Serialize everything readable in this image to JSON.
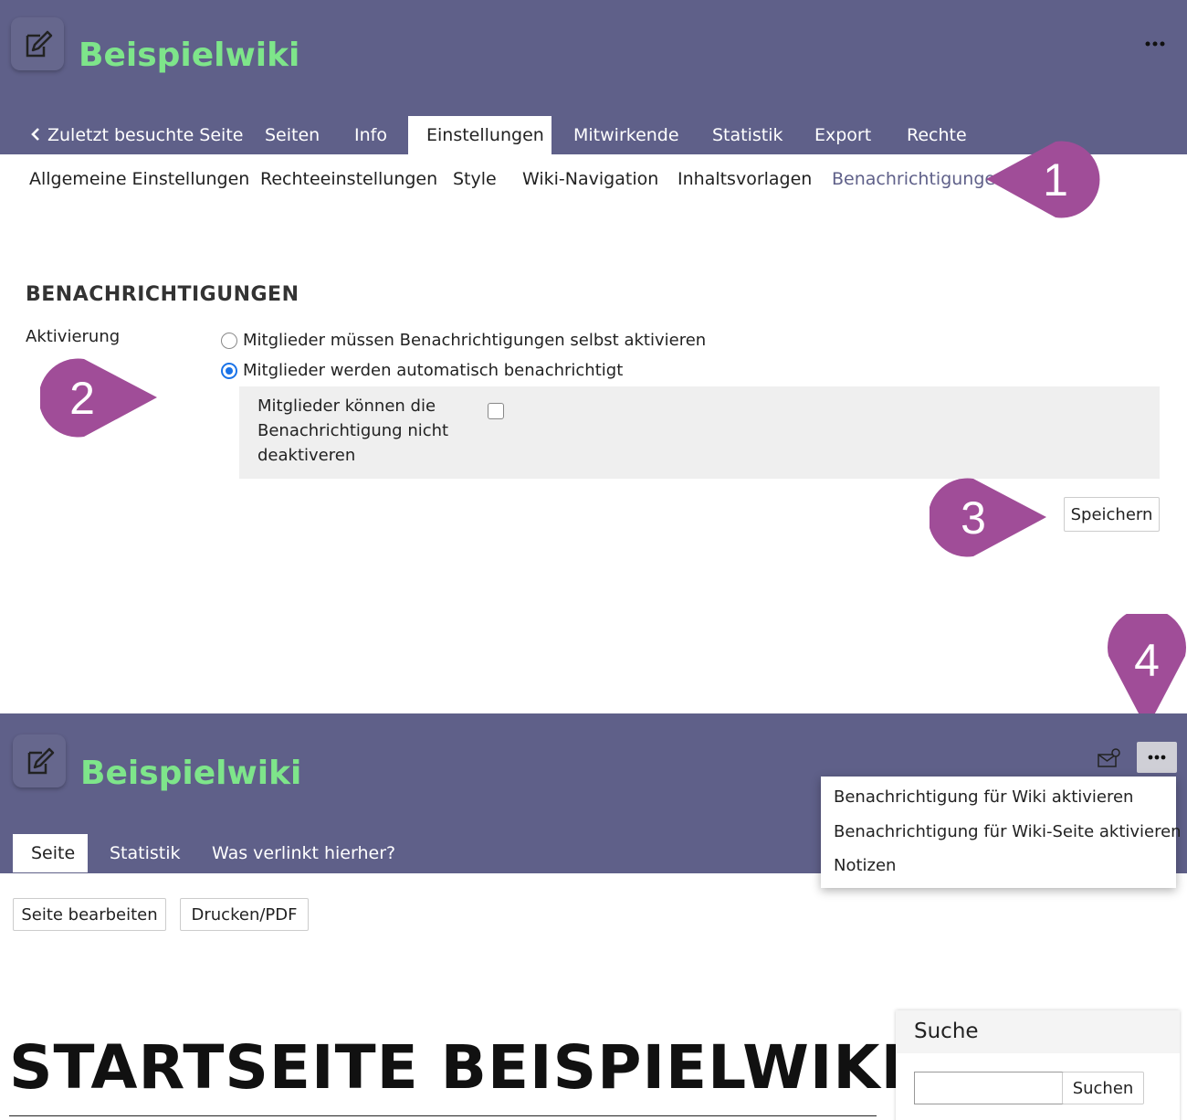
{
  "top": {
    "wiki_title": "Beispielwiki",
    "tabs": [
      {
        "label": "Zuletzt besuchte Seite",
        "icon": "chevron-left-icon"
      },
      {
        "label": "Seiten"
      },
      {
        "label": "Info"
      },
      {
        "label": "Einstellungen",
        "active": true
      },
      {
        "label": "Mitwirkende"
      },
      {
        "label": "Statistik"
      },
      {
        "label": "Export"
      },
      {
        "label": "Rechte"
      }
    ],
    "more_icon": "more-horizontal-icon"
  },
  "subnav": [
    {
      "label": "Allgemeine Einstellungen"
    },
    {
      "label": "Rechteeinstellungen"
    },
    {
      "label": "Style"
    },
    {
      "label": "Wiki-Navigation"
    },
    {
      "label": "Inhaltsvorlagen"
    },
    {
      "label": "Benachrichtigungen",
      "active": true
    }
  ],
  "settings": {
    "section_title": "BENACHRICHTIGUNGEN",
    "field_label": "Aktivierung",
    "options": [
      {
        "label": "Mitglieder müssen Benachrichtigungen selbst aktivieren",
        "checked": false
      },
      {
        "label": "Mitglieder werden automatisch benachrichtigt",
        "checked": true
      }
    ],
    "sub_option": {
      "label": "Mitglieder können die Benachrichtigung nicht deaktiveren",
      "checked": false
    },
    "save_label": "Speichern"
  },
  "markers": [
    "1",
    "2",
    "3",
    "4"
  ],
  "marker_color": "#a04d98",
  "bottom": {
    "wiki_title": "Beispielwiki",
    "tabs": [
      {
        "label": "Seite",
        "active": true
      },
      {
        "label": "Statistik"
      },
      {
        "label": "Was verlinkt hierher?"
      }
    ],
    "notify_icon": "mail-notification-icon",
    "more_icon": "more-horizontal-icon",
    "dropdown": [
      "Benachrichtigung für Wiki aktivieren",
      "Benachrichtigung für Wiki-Seite aktivieren",
      "Notizen"
    ],
    "buttons": {
      "edit": "Seite bearbeiten",
      "print": "Drucken/PDF"
    },
    "page_heading": "STARTSEITE BEISPIELWIKI",
    "search": {
      "title": "Suche",
      "button": "Suchen",
      "value": ""
    }
  },
  "colors": {
    "header": "#5f6089",
    "title": "#7ee58a",
    "accent": "#a04d98",
    "radio": "#1a73e8"
  }
}
